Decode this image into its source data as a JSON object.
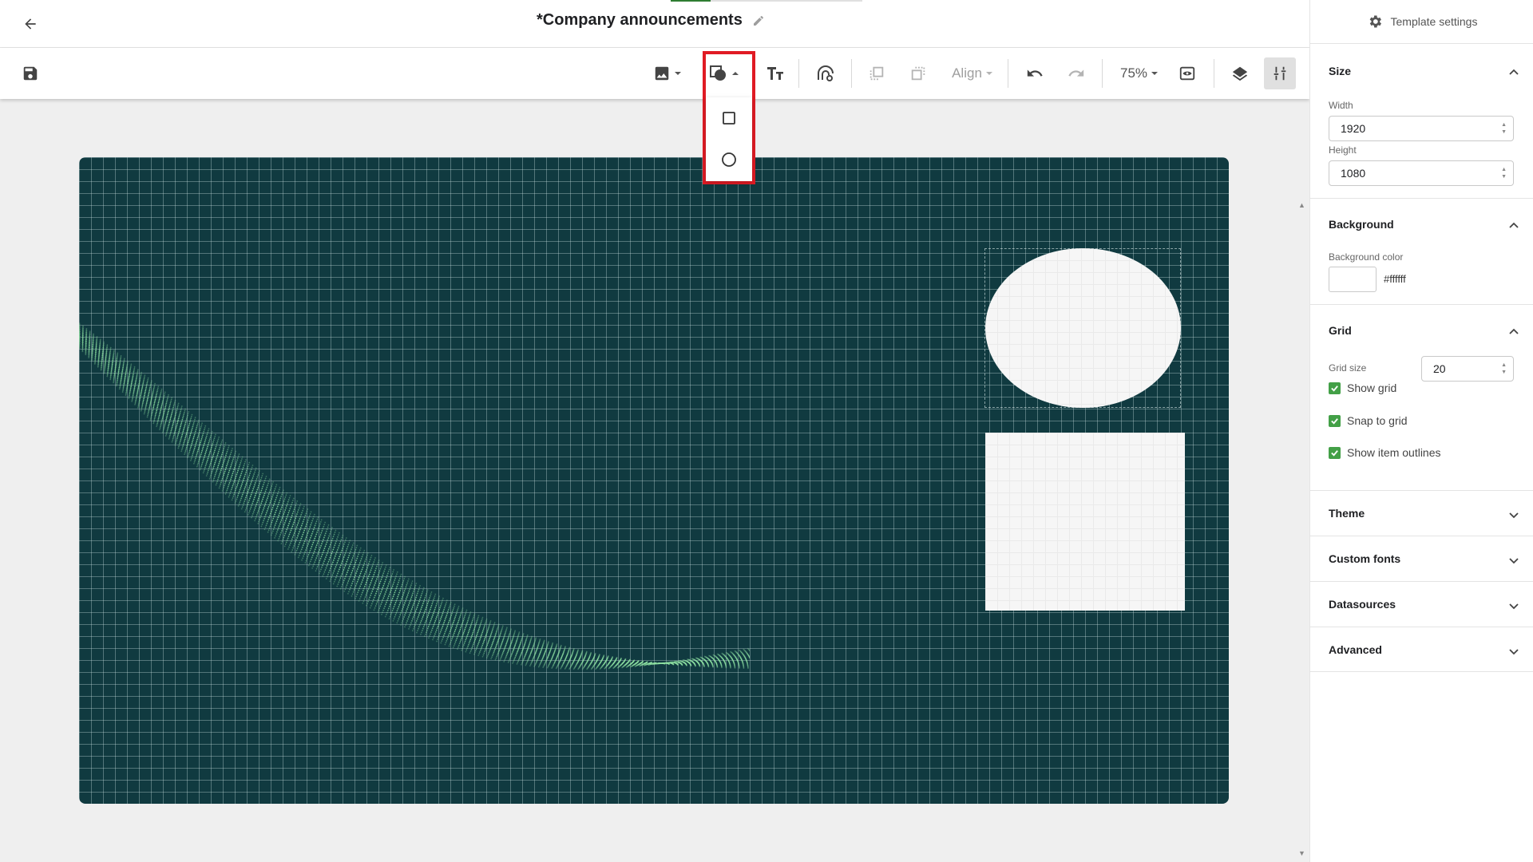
{
  "header": {
    "title": "*Company announcements"
  },
  "toolbar": {
    "align_label": "Align",
    "zoom": "75%"
  },
  "shape_menu": {
    "items": [
      "rectangle-shape",
      "circle-shape"
    ]
  },
  "panel": {
    "title": "Template settings",
    "size": {
      "title": "Size",
      "width_label": "Width",
      "width_value": "1920",
      "height_label": "Height",
      "height_value": "1080"
    },
    "background": {
      "title": "Background",
      "color_label": "Background color",
      "color_value": "#ffffff"
    },
    "grid": {
      "title": "Grid",
      "size_label": "Grid size",
      "size_value": "20",
      "show_grid": "Show grid",
      "snap": "Snap to grid",
      "outlines": "Show item outlines"
    },
    "theme": "Theme",
    "custom_fonts": "Custom fonts",
    "datasources": "Datasources",
    "advanced": "Advanced"
  },
  "colors": {
    "canvas": "#103a40",
    "accent": "#43a047",
    "highlight": "#e01b24",
    "wave": "#8fe3a3"
  }
}
